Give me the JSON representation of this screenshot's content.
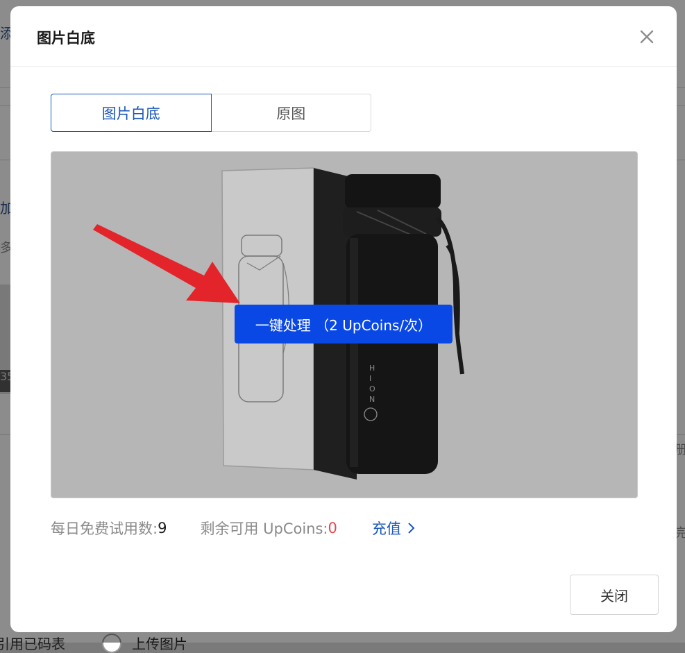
{
  "background": {
    "fragments": [
      "添",
      "加",
      "多",
      "35"
    ],
    "bottom_left_text": "引用已码表",
    "bottom_radio_label": "上传图片",
    "right_fragments": [
      "册",
      "完"
    ]
  },
  "modal": {
    "title": "图片白底",
    "tabs": [
      {
        "label": "图片白底",
        "active": true
      },
      {
        "label": "原图",
        "active": false
      }
    ],
    "process_button_label": "一键处理 （2 UpCoins/次）",
    "stats": {
      "daily_free_label": "每日免费试用数: ",
      "daily_free_value": "9",
      "remaining_label": "剩余可用 UpCoins: ",
      "remaining_value": "0",
      "recharge_label": "充值"
    },
    "close_button_label": "关闭"
  },
  "colors": {
    "accent": "#0a48e6",
    "link": "#1a57b8",
    "zero_value": "#e5484d"
  }
}
